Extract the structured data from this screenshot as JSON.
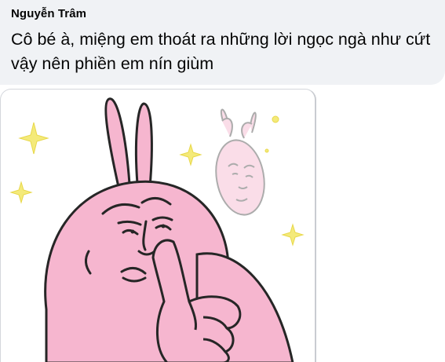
{
  "comment": {
    "author": "Nguyễn Trâm",
    "message": "Cô bé à, miệng em thoát ra những lời ngọc ngà như cứt vậy nên phiền em nín giùm"
  },
  "sticker": {
    "subject": "pink bunny meme sticker with finger on lips",
    "colors": {
      "bunny_pink": "#f6b6cf",
      "outline": "#2b2b2b",
      "sparkle": "#f2e66a"
    }
  }
}
